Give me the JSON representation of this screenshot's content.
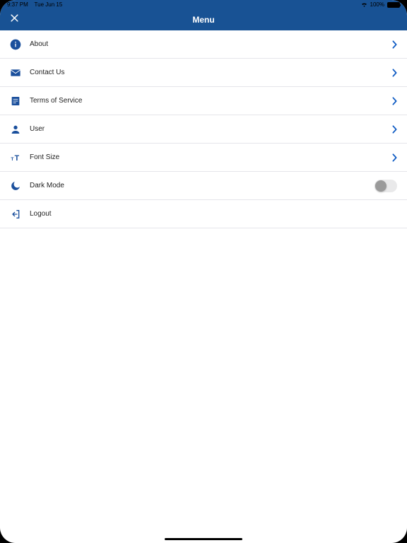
{
  "status": {
    "time": "9:37 PM",
    "date": "Tue Jun 15",
    "battery": "100%"
  },
  "navbar": {
    "title": "Menu"
  },
  "rows": {
    "about": {
      "label": "About"
    },
    "contact": {
      "label": "Contact Us"
    },
    "terms": {
      "label": "Terms of Service"
    },
    "user": {
      "label": "User"
    },
    "fontsize": {
      "label": "Font Size"
    },
    "darkmode": {
      "label": "Dark Mode"
    },
    "logout": {
      "label": "Logout"
    }
  },
  "colors": {
    "accent": "#185294",
    "iconBlue": "#1a4f9c",
    "chevron": "#0a58c2"
  }
}
